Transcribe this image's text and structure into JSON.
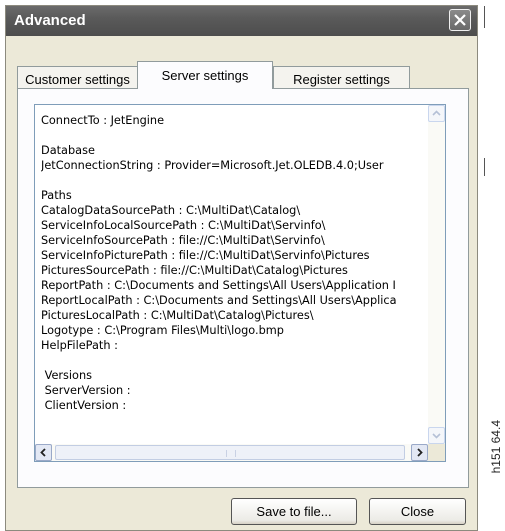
{
  "window": {
    "title": "Advanced"
  },
  "tabs": [
    {
      "label": "Customer settings",
      "active": false
    },
    {
      "label": "Server settings",
      "active": true
    },
    {
      "label": "Register settings",
      "active": false
    }
  ],
  "server_settings": {
    "lines": [
      "ConnectTo : JetEngine",
      "",
      "Database",
      "JetConnectionString : Provider=Microsoft.Jet.OLEDB.4.0;User",
      "",
      "Paths",
      "CatalogDataSourcePath : C:\\MultiDat\\Catalog\\",
      "ServiceInfoLocalSourcePath : C:\\MultiDat\\Servinfo\\",
      "ServiceInfoSourcePath : file://C:\\MultiDat\\Servinfo\\",
      "ServiceInfoPicturePath : file://C:\\MultiDat\\Servinfo\\Pictures",
      "PicturesSourcePath : file://C:\\MultiDat\\Catalog\\Pictures",
      "ReportPath : C:\\Documents and Settings\\All Users\\Application I",
      "ReportLocalPath : C:\\Documents and Settings\\All Users\\Applica",
      "PicturesLocalPath : C:\\MultiDat\\Catalog\\Pictures\\",
      "Logotype : C:\\Program Files\\Multi\\logo.bmp",
      "HelpFilePath :",
      "",
      " Versions",
      " ServerVersion :",
      " ClientVersion :"
    ]
  },
  "buttons": {
    "save": "Save to file...",
    "close": "Close"
  },
  "side_label": "h151 64.4",
  "icons": {
    "close": "close-icon",
    "up": "arrow-up-icon",
    "down": "arrow-down-icon",
    "left": "arrow-left-icon",
    "right": "arrow-right-icon"
  }
}
